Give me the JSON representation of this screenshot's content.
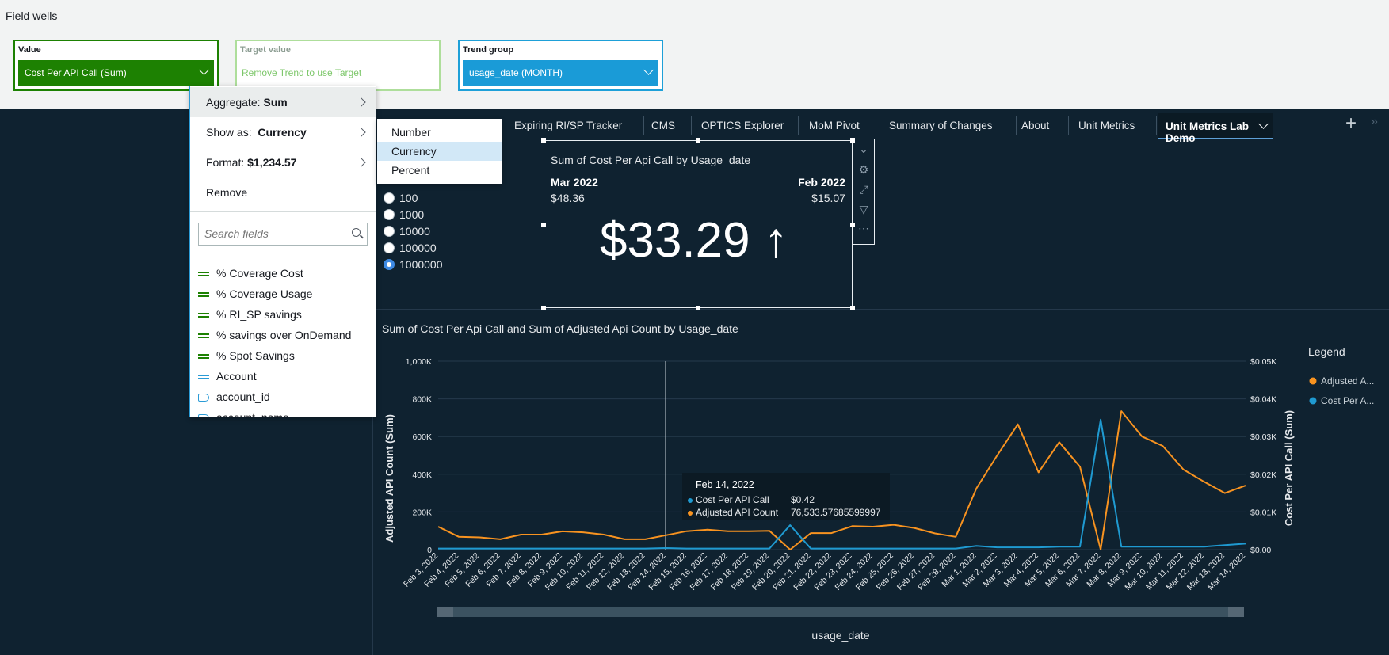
{
  "field_wells": {
    "title": "Field wells",
    "value": {
      "label": "Value",
      "selected": "Cost Per API Call (Sum)"
    },
    "target": {
      "label": "Target value",
      "hint": "Remove Trend to use Target"
    },
    "trend": {
      "label": "Trend group",
      "selected": "usage_date (MONTH)"
    }
  },
  "tabs": [
    "Expiring RI/SP Tracker",
    "CMS",
    "OPTICS Explorer",
    "MoM Pivot",
    "Summary of Changes",
    "About",
    "Unit Metrics"
  ],
  "active_tab": "Unit Metrics Lab Demo",
  "radio_options": [
    "100",
    "1000",
    "10000",
    "100000",
    "1000000"
  ],
  "radio_selected": "1000000",
  "kpi": {
    "title": "Sum of Cost Per Api Call by Usage_date",
    "left_period": "Mar 2022",
    "left_value": "$48.36",
    "right_period": "Feb 2022",
    "right_value": "$15.07",
    "big_value": "$33.29 ↑"
  },
  "menu": {
    "aggregate_label": "Aggregate:",
    "aggregate_value": "Sum",
    "show_as_label": "Show as:",
    "show_as_value": "Currency",
    "format_label": "Format:",
    "format_value": "$1,234.57",
    "remove": "Remove",
    "search_placeholder": "Search fields",
    "fields": [
      "% Coverage Cost",
      "% Coverage Usage",
      "% RI_SP savings",
      "% savings over OnDemand",
      "% Spot Savings",
      "Account",
      "account_id",
      "account_name"
    ]
  },
  "submenu": [
    "Number",
    "Currency",
    "Percent"
  ],
  "submenu_selected": "Currency",
  "tooltip": {
    "date": "Feb 14, 2022",
    "row1_label": "Cost Per API Call",
    "row1_value": "$0.42",
    "row2_label": "Adjusted API Count",
    "row2_value": "76,533.57685599997"
  },
  "colors": {
    "orange": "#f89320",
    "blue": "#1f9ad1",
    "green": "#1d8102"
  },
  "chart_data": {
    "type": "line",
    "title": "Sum of Cost Per Api Call and Sum of Adjusted Api Count by Usage_date",
    "xlabel": "usage_date",
    "ylabel": "Adjusted API Count (Sum)",
    "y2label": "Cost Per API Call (Sum)",
    "categories": [
      "Feb 3, 2022",
      "Feb 4, 2022",
      "Feb 5, 2022",
      "Feb 6, 2022",
      "Feb 7, 2022",
      "Feb 8, 2022",
      "Feb 9, 2022",
      "Feb 10, 2022",
      "Feb 11, 2022",
      "Feb 12, 2022",
      "Feb 13, 2022",
      "Feb 14, 2022",
      "Feb 15, 2022",
      "Feb 16, 2022",
      "Feb 17, 2022",
      "Feb 18, 2022",
      "Feb 19, 2022",
      "Feb 20, 2022",
      "Feb 21, 2022",
      "Feb 22, 2022",
      "Feb 23, 2022",
      "Feb 24, 2022",
      "Feb 25, 2022",
      "Feb 26, 2022",
      "Feb 27, 2022",
      "Feb 28, 2022",
      "Mar 1, 2022",
      "Mar 2, 2022",
      "Mar 3, 2022",
      "Mar 4, 2022",
      "Mar 5, 2022",
      "Mar 6, 2022",
      "Mar 7, 2022",
      "Mar 8, 2022",
      "Mar 9, 2022",
      "Mar 10, 2022",
      "Mar 11, 2022",
      "Mar 12, 2022",
      "Mar 13, 2022",
      "Mar 14, 2022"
    ],
    "yticks": [
      "0",
      "200K",
      "400K",
      "600K",
      "800K",
      "1,000K"
    ],
    "y2ticks": [
      "$0.00",
      "$0.01K",
      "$0.02K",
      "$0.03K",
      "$0.04K",
      "$0.05K"
    ],
    "ylim": [
      0,
      1000000
    ],
    "y2lim": [
      0,
      50
    ],
    "legend_title": "Legend",
    "legend_position": "right",
    "series": [
      {
        "name": "Adjusted A...",
        "axis": "left",
        "color": "#f89320",
        "values": [
          122000,
          68000,
          65000,
          55000,
          80000,
          80000,
          97000,
          92000,
          80000,
          55000,
          55000,
          76533,
          98000,
          106000,
          98000,
          98000,
          100000,
          0,
          88000,
          88000,
          125000,
          122000,
          132000,
          115000,
          86000,
          68000,
          325000,
          500000,
          665000,
          410000,
          570000,
          440000,
          0,
          735000,
          600000,
          550000,
          425000,
          360000,
          300000,
          340000
        ]
      },
      {
        "name": "Cost Per A...",
        "axis": "right",
        "color": "#1f9ad1",
        "values": [
          0.3,
          0.3,
          0.3,
          0.3,
          0.3,
          0.3,
          0.3,
          0.3,
          0.3,
          0.3,
          0.3,
          0.42,
          0.3,
          0.3,
          0.3,
          0.3,
          0.3,
          6.5,
          0.3,
          0.3,
          0.3,
          0.3,
          0.3,
          0.3,
          0.3,
          0.3,
          1,
          0.6,
          0.6,
          0.6,
          0.8,
          0.8,
          34.5,
          0.8,
          0.8,
          0.8,
          0.8,
          0.8,
          1.2,
          1.6
        ]
      }
    ]
  }
}
